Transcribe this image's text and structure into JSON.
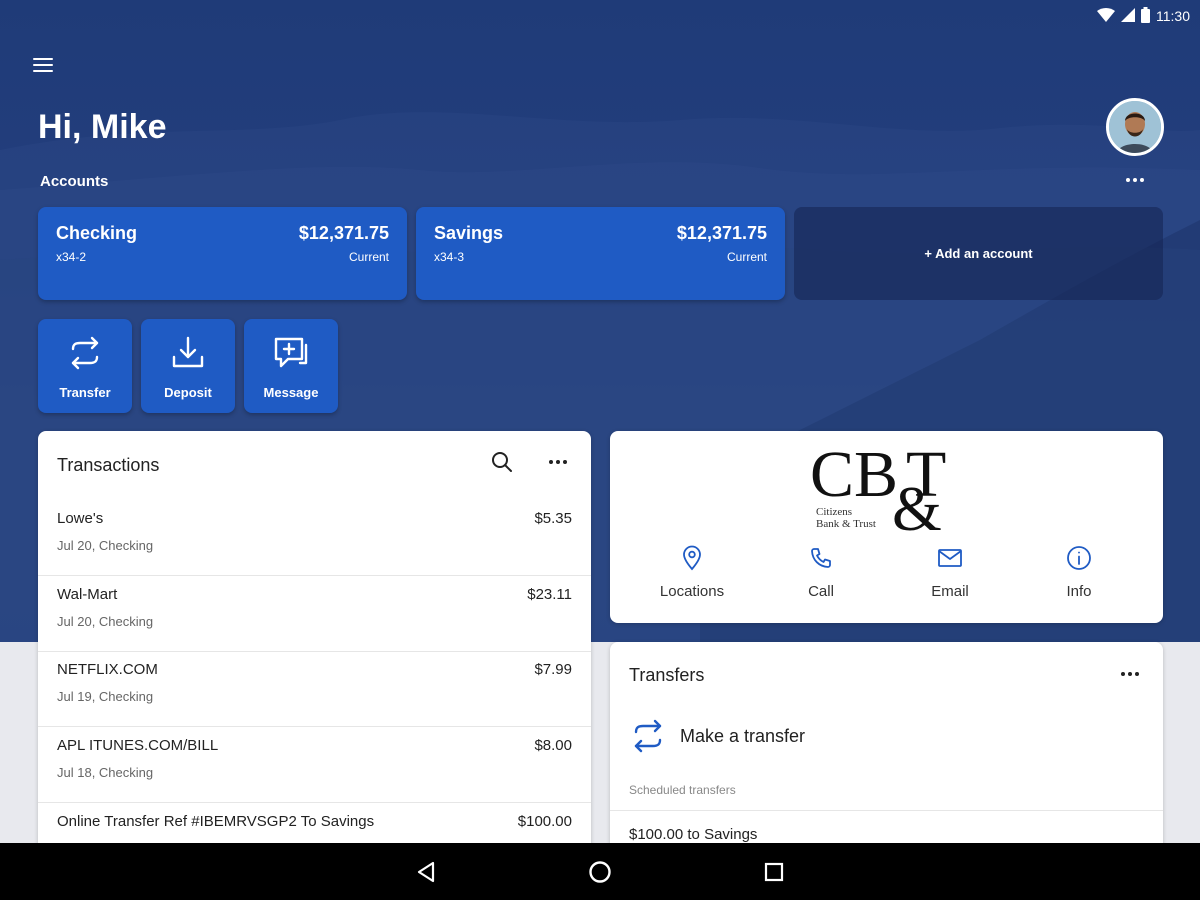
{
  "status_bar": {
    "time": "11:30"
  },
  "header": {
    "greeting": "Hi, Mike"
  },
  "accounts": {
    "label": "Accounts",
    "items": [
      {
        "name": "Checking",
        "number": "x34-2",
        "balance": "$12,371.75",
        "balance_type": "Current"
      },
      {
        "name": "Savings",
        "number": "x34-3",
        "balance": "$12,371.75",
        "balance_type": "Current"
      }
    ],
    "add_label": "+ Add an account"
  },
  "actions": [
    {
      "label": "Transfer",
      "icon": "transfer-icon"
    },
    {
      "label": "Deposit",
      "icon": "deposit-icon"
    },
    {
      "label": "Message",
      "icon": "message-icon"
    }
  ],
  "transactions": {
    "title": "Transactions",
    "items": [
      {
        "merchant": "Lowe's",
        "amount": "$5.35",
        "meta": "Jul 20, Checking"
      },
      {
        "merchant": "Wal-Mart",
        "amount": "$23.11",
        "meta": "Jul 20, Checking"
      },
      {
        "merchant": "NETFLIX.COM",
        "amount": "$7.99",
        "meta": "Jul 19, Checking"
      },
      {
        "merchant": "APL ITUNES.COM/BILL",
        "amount": "$8.00",
        "meta": "Jul 18, Checking"
      },
      {
        "merchant": "Online Transfer Ref #IBEMRVSGP2 To Savings",
        "amount": "$100.00",
        "meta": ""
      }
    ]
  },
  "bank": {
    "logo_text": "CB&T",
    "logo_subtext_1": "Citizens",
    "logo_subtext_2": "Bank & Trust",
    "contacts": [
      {
        "label": "Locations",
        "icon": "location-pin-icon"
      },
      {
        "label": "Call",
        "icon": "phone-icon"
      },
      {
        "label": "Email",
        "icon": "mail-icon"
      },
      {
        "label": "Info",
        "icon": "info-icon"
      }
    ]
  },
  "transfers": {
    "title": "Transfers",
    "make_label": "Make a transfer",
    "scheduled_label": "Scheduled transfers",
    "scheduled_items": [
      "$100.00 to Savings"
    ]
  },
  "colors": {
    "hero_bg": "#243f7e",
    "card_blue": "#1f5bc4",
    "accent": "#1f5bc4"
  }
}
